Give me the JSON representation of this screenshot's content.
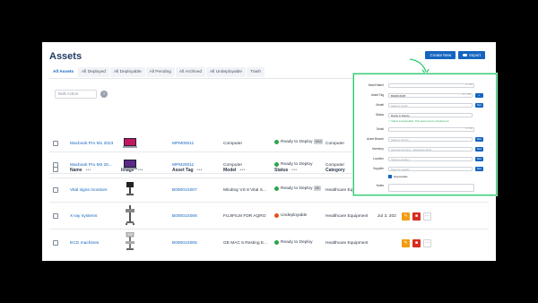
{
  "page": {
    "title": "Assets",
    "create_new_label": "Create New",
    "import_label": "Import"
  },
  "tabs": [
    "All Assets",
    "All Deployed",
    "All Deployable",
    "All Pending",
    "All Archived",
    "All Undeployable",
    "Trash"
  ],
  "bulk_action": {
    "placeholder": "Bulk Action"
  },
  "columns": [
    "Name",
    "Image",
    "Asset Tag",
    "Model",
    "Status",
    "Category"
  ],
  "rows": [
    {
      "name": "Macbook Pro M1 2023",
      "asset_tag": "MPM00011",
      "model": "Computer",
      "status": "Ready to Deploy",
      "status_chip": "MAC",
      "status_color": "#2ea44f",
      "category": "Computer",
      "image": "laptop-image"
    },
    {
      "name": "Macbook Pro M2 20...",
      "asset_tag": "MPM20011",
      "model": "Computer",
      "status": "Ready to Deploy",
      "status_chip": "",
      "status_color": "#2ea44f",
      "category": "Computer",
      "image": "laptop-image"
    },
    {
      "name": "Vital signs monitors",
      "asset_tag": "B00001S007",
      "model": "Mindray VS 8 Vital S...",
      "status": "Ready to Deploy",
      "status_chip": "MK",
      "status_color": "#2ea44f",
      "category": "Healthcare Equipment",
      "image": "monitor-image"
    },
    {
      "name": "X-ray systems",
      "asset_tag": "B00001S006",
      "model": "FUJIFILM FDR AQRO",
      "status": "Undeployable",
      "status_chip": "",
      "status_color": "#e0541d",
      "category": "Healthcare Equipment",
      "extra": "Jul 3, 202",
      "image": "xray-image"
    },
    {
      "name": "ECG machines",
      "asset_tag": "B00001S005",
      "model": "GE MAC 5 Resting E...",
      "status": "Ready to Deploy",
      "status_chip": "",
      "status_color": "#2ea44f",
      "category": "Healthcare Equipment",
      "image": "ecg-image"
    }
  ],
  "form": {
    "fields": [
      {
        "label": "Asset Name",
        "value": "",
        "right": "0 / 100"
      },
      {
        "label": "Asset Tag",
        "value": "B00001S008",
        "right": "00 / 100",
        "button": ""
      },
      {
        "label": "Model",
        "value": "Select a model",
        "button": "New"
      },
      {
        "label": "Status",
        "value": "Ready to Deploy",
        "button": ""
      },
      {
        "label": "Serial",
        "value": "",
        "right": "0 / 100"
      },
      {
        "label": "Asset Branch",
        "value": "Select a branch",
        "button": "New"
      },
      {
        "label": "Inventory",
        "value": "General Inventory - Downtown Store",
        "button": "New"
      },
      {
        "label": "Location",
        "value": "Select a location",
        "button": "New"
      },
      {
        "label": "Supplier",
        "value": "Select a supplier",
        "button": "New"
      }
    ],
    "status_note": "✓ Status is deployable. This asset can be checked out",
    "requestable_label": "Requestable",
    "notes_label": "Notes"
  },
  "colors": {
    "primary": "#1565c0",
    "ready": "#2ea44f",
    "undeployable": "#e0541d",
    "edit": "#f39c12",
    "delete": "#d62d20",
    "overlay_border": "#2ecc71"
  }
}
